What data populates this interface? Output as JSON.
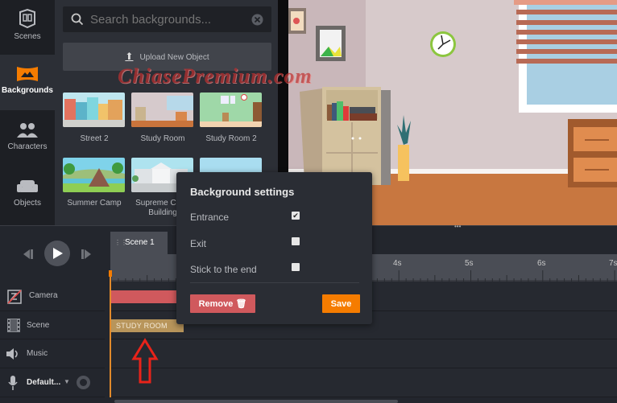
{
  "sidebar": {
    "items": [
      {
        "label": "Scenes",
        "icon": "scenes-cube-icon"
      },
      {
        "label": "Backgrounds",
        "icon": "backgrounds-image-icon",
        "active": true
      },
      {
        "label": "Characters",
        "icon": "characters-people-icon"
      },
      {
        "label": "Objects",
        "icon": "objects-sofa-icon"
      }
    ]
  },
  "panel": {
    "search": {
      "placeholder": "Search backgrounds...",
      "value": ""
    },
    "upload_label": "Upload New Object",
    "backgrounds": [
      {
        "label": "Street 2"
      },
      {
        "label": "Study Room"
      },
      {
        "label": "Study Room 2"
      },
      {
        "label": "Summer Camp"
      },
      {
        "label": "Supreme Court Building"
      },
      {
        "label": ""
      }
    ]
  },
  "watermark": "ChiasePremium.com",
  "timeline": {
    "tab": "Scene 1",
    "ruler": {
      "labels": [
        "4s",
        "5s",
        "6s",
        "7s"
      ]
    },
    "tracks": [
      {
        "label": "Camera",
        "icon": "camera-icon"
      },
      {
        "label": "Scene",
        "icon": "film-icon"
      },
      {
        "label": "Music",
        "icon": "speaker-icon"
      },
      {
        "label": "Default...",
        "icon": "microphone-icon"
      }
    ],
    "scene_clip": "STUDY ROOM"
  },
  "popup": {
    "title": "Background settings",
    "options": [
      {
        "label": "Entrance",
        "checked": true
      },
      {
        "label": "Exit",
        "checked": false
      },
      {
        "label": "Stick to the end",
        "checked": false
      }
    ],
    "remove_label": "Remove",
    "save_label": "Save"
  },
  "colors": {
    "accent": "#f57c00",
    "danger": "#d0595d",
    "scene_clip": "#b8955b",
    "annotation_arrow": "#e8231a"
  }
}
